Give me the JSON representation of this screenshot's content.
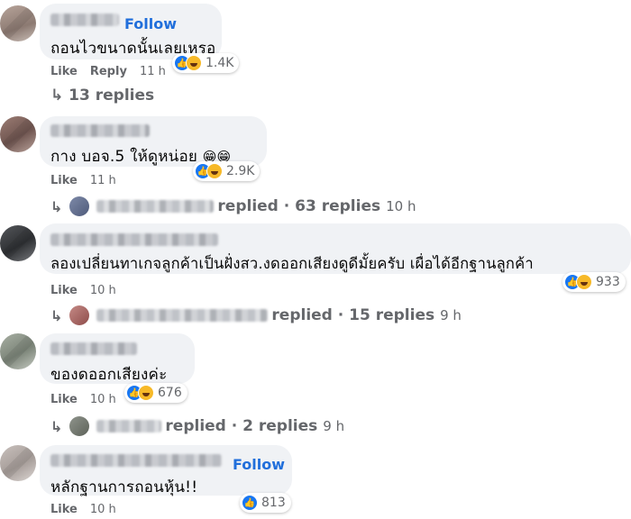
{
  "follow_label": "Follow",
  "like_label": "Like",
  "reply_label": "Reply",
  "comments": [
    {
      "text": "ถอนไวขนาดนั้นเลยเหรอ",
      "reaction_count": "1.4K",
      "time": "11 h",
      "replies": "↳ 13 replies"
    },
    {
      "text": "กาง บอจ.5 ให้ดูหน่อย",
      "emoji": "😁😁",
      "reaction_count": "2.9K",
      "time": "11 h",
      "replied": "replied · 63 replies",
      "replied_time": "10 h"
    },
    {
      "text": "ลองเปลี่ยนทาเกจลูกค้าเป็นฝั่งสว.งดออกเสียงดูดีมั้ยครับ เผื่อได้อีกฐานลูกค้า",
      "reaction_count": "933",
      "time": "10 h",
      "replied": "replied · 15 replies",
      "replied_time": "9 h"
    },
    {
      "text": "ของดออกเสียงค่ะ",
      "reaction_count": "676",
      "time": "10 h",
      "replied": "replied · 2 replies",
      "replied_time": "9 h"
    },
    {
      "text": "หลักฐานการถอนหุ้น!!",
      "reaction_count": "813",
      "time": "10 h"
    }
  ]
}
